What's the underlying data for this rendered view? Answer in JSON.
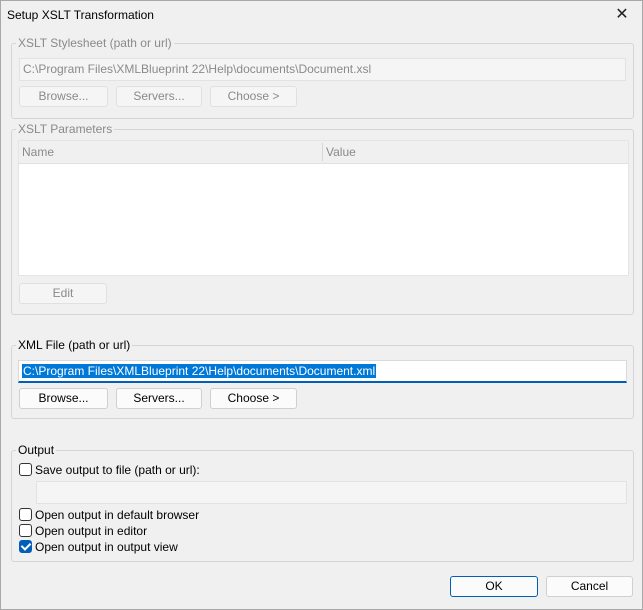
{
  "window": {
    "title": "Setup XSLT Transformation"
  },
  "stylesheet": {
    "group_title": "XSLT Stylesheet (path or url)",
    "path": "C:\\Program Files\\XMLBlueprint 22\\Help\\documents\\Document.xsl",
    "browse_label": "Browse...",
    "servers_label": "Servers...",
    "choose_label": "Choose >"
  },
  "parameters": {
    "group_title": "XSLT Parameters",
    "columns": [
      "Name",
      "Value"
    ],
    "rows": [],
    "edit_label": "Edit"
  },
  "xmlfile": {
    "group_title": "XML File (path or url)",
    "path": "C:\\Program Files\\XMLBlueprint 22\\Help\\documents\\Document.xml",
    "browse_label": "Browse...",
    "servers_label": "Servers...",
    "choose_label": "Choose >"
  },
  "output": {
    "group_title": "Output",
    "save_to_file": {
      "label": "Save output to file (path or url):",
      "checked": false
    },
    "save_path": "",
    "options": [
      {
        "label": "Open output in default browser",
        "checked": false
      },
      {
        "label": "Open output in editor",
        "checked": false
      },
      {
        "label": "Open output in output view",
        "checked": true
      }
    ]
  },
  "footer": {
    "ok_label": "OK",
    "cancel_label": "Cancel"
  }
}
